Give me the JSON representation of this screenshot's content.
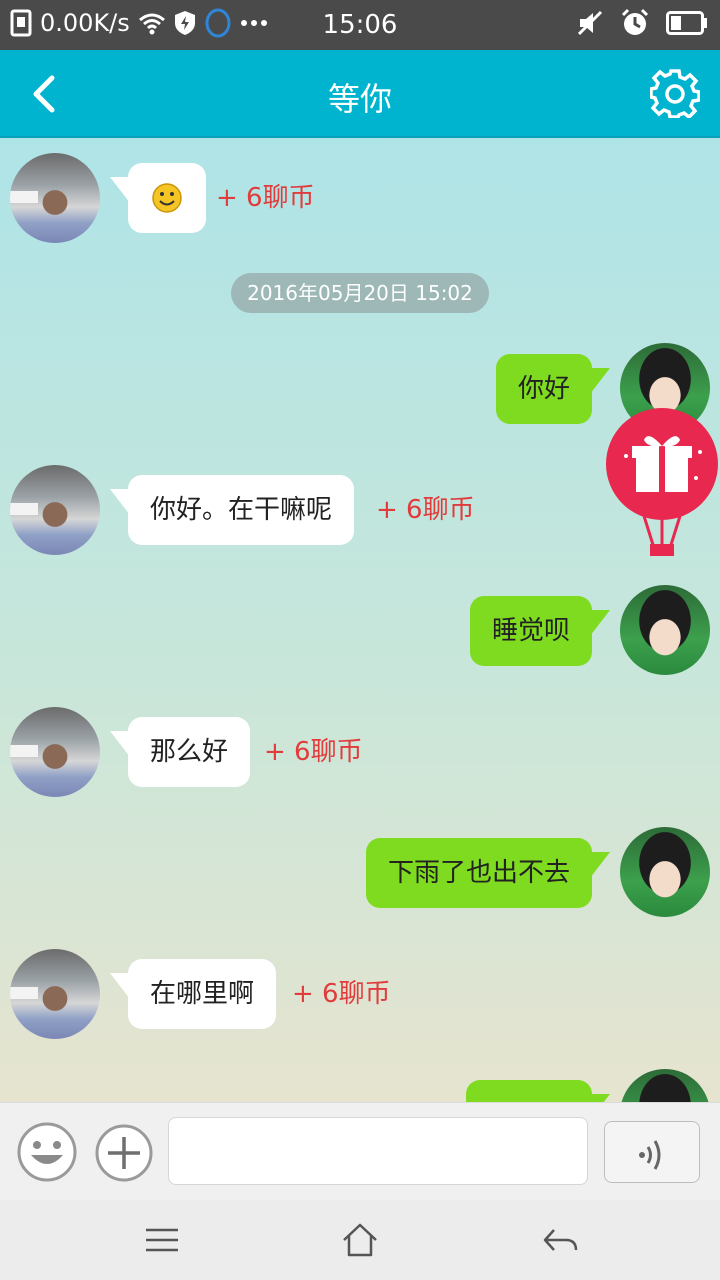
{
  "status_bar": {
    "speed": "0.00K/s",
    "time": "15:06",
    "icons": [
      "sim-icon",
      "wifi-icon",
      "shield-icon",
      "circle-icon",
      "more-icon",
      "mute-icon",
      "alarm-icon",
      "battery-icon"
    ]
  },
  "header": {
    "title": "等你",
    "back_icon": "chevron-left-icon",
    "settings_icon": "gear-icon"
  },
  "chat": {
    "timestamp": "2016年05月20日 15:02",
    "messages": [
      {
        "side": "left",
        "text": "",
        "emoji": "smiley",
        "reward": "+ 6聊币"
      },
      {
        "side": "right",
        "text": "你好"
      },
      {
        "side": "left",
        "text": "你好。在干嘛呢",
        "reward": "+ 6聊币"
      },
      {
        "side": "right",
        "text": "睡觉呗"
      },
      {
        "side": "left",
        "text": "那么好",
        "reward": "+ 6聊币"
      },
      {
        "side": "right",
        "text": "下雨了也出不去"
      },
      {
        "side": "left",
        "text": "在哪里啊",
        "reward": "+ 6聊币"
      },
      {
        "side": "right",
        "text": ""
      }
    ],
    "gift_icon": "gift-balloon-icon"
  },
  "input_bar": {
    "text_value": "",
    "placeholder": "",
    "icons": [
      "emoji-icon",
      "plus-icon",
      "voice-icon"
    ]
  },
  "nav_bar": {
    "icons": [
      "menu-icon",
      "home-icon",
      "back-arrow-icon"
    ]
  },
  "colors": {
    "header": "#00b4cf",
    "sent_bubble": "#7edb1f",
    "received_bubble": "#ffffff",
    "reward_text": "#e23b3b",
    "gift": "#e8284f"
  }
}
